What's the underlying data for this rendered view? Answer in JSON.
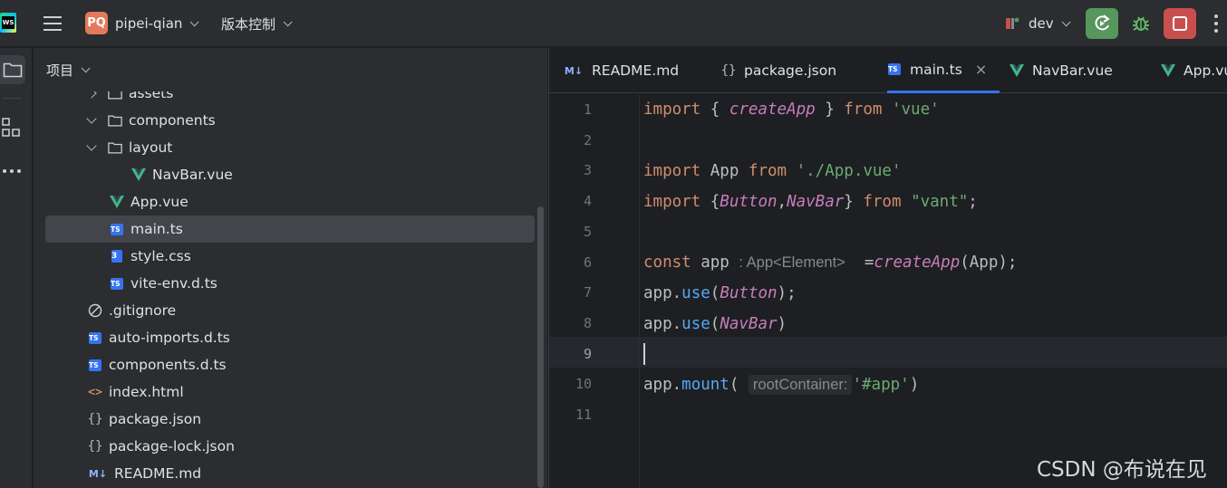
{
  "topbar": {
    "logo_text": "WS",
    "project_badge": "PQ",
    "project_name": "pipei-qian",
    "vcs_label": "版本控制",
    "branch": "dev"
  },
  "panel": {
    "title": "项目",
    "tree": [
      {
        "label": "assets",
        "icon": "folder-icon",
        "indent": 2,
        "arrow": "right"
      },
      {
        "label": "components",
        "icon": "folder-icon",
        "indent": 2,
        "arrow": "down"
      },
      {
        "label": "layout",
        "icon": "folder-icon",
        "indent": 2,
        "arrow": "down"
      },
      {
        "label": "NavBar.vue",
        "icon": "vue-icon",
        "indent": 4,
        "arrow": ""
      },
      {
        "label": "App.vue",
        "icon": "vue-icon",
        "indent": 3,
        "arrow": ""
      },
      {
        "label": "main.ts",
        "icon": "ts-icon",
        "indent": 3,
        "arrow": "",
        "selected": true
      },
      {
        "label": "style.css",
        "icon": "css-icon",
        "indent": 3,
        "arrow": ""
      },
      {
        "label": "vite-env.d.ts",
        "icon": "ts-icon",
        "indent": 3,
        "arrow": ""
      },
      {
        "label": ".gitignore",
        "icon": "ignore-icon",
        "indent": 2,
        "arrow": ""
      },
      {
        "label": "auto-imports.d.ts",
        "icon": "ts-icon",
        "indent": 2,
        "arrow": ""
      },
      {
        "label": "components.d.ts",
        "icon": "ts-icon",
        "indent": 2,
        "arrow": ""
      },
      {
        "label": "index.html",
        "icon": "html-icon",
        "indent": 2,
        "arrow": ""
      },
      {
        "label": "package.json",
        "icon": "json-icon",
        "indent": 2,
        "arrow": ""
      },
      {
        "label": "package-lock.json",
        "icon": "json-icon",
        "indent": 2,
        "arrow": ""
      },
      {
        "label": "README.md",
        "icon": "md-icon",
        "indent": 2,
        "arrow": ""
      }
    ]
  },
  "editor": {
    "tabs": [
      {
        "label": "README.md",
        "icon": "md-icon"
      },
      {
        "label": "package.json",
        "icon": "json-icon"
      },
      {
        "label": "main.ts",
        "icon": "ts-icon",
        "active": true
      },
      {
        "label": "NavBar.vue",
        "icon": "vue-icon"
      },
      {
        "label": "App.vue",
        "icon": "vue-icon"
      }
    ],
    "close_glyph": "×",
    "line_numbers": [
      "1",
      "2",
      "3",
      "4",
      "5",
      "6",
      "7",
      "8",
      "9",
      "10",
      "11"
    ],
    "current_line": "9",
    "code": {
      "l1": {
        "kw": "import",
        "p1": " { ",
        "fn": "createApp",
        "p2": " } ",
        "from": "from",
        "sp": " ",
        "str": "'vue'"
      },
      "l3": {
        "kw": "import",
        "p1": " App ",
        "from": "from",
        "sp": " ",
        "str": "'./App.vue'"
      },
      "l4": {
        "kw": "import",
        "p1": " {",
        "fn1": "Button",
        "comma": ",",
        "fn2": "NavBar",
        "p2": "} ",
        "from": "from",
        "sp": " ",
        "str": "\"vant\"",
        "end": ";"
      },
      "l6": {
        "kw": "const",
        "p1": " app ",
        "hint": ": App<Element>",
        "p2": "  =",
        "fn": "createApp",
        "p3": "(App);"
      },
      "l7": {
        "obj": "app",
        "dot": ".",
        "meth": "use",
        "open": "(",
        "fn": "Button",
        "close": ");"
      },
      "l8": {
        "obj": "app",
        "dot": ".",
        "meth": "use",
        "open": "(",
        "fn": "NavBar",
        "close": ")"
      },
      "l10": {
        "obj": "app",
        "dot": ".",
        "meth": "mount",
        "open": "( ",
        "hint": "rootContainer:",
        "str": "'#app'",
        "close": ")"
      }
    }
  },
  "watermark": "CSDN @布说在见",
  "colors": {
    "accent": "#3574f0",
    "run": "#57965c",
    "stop": "#c94f4f",
    "vue": "#41b883"
  }
}
